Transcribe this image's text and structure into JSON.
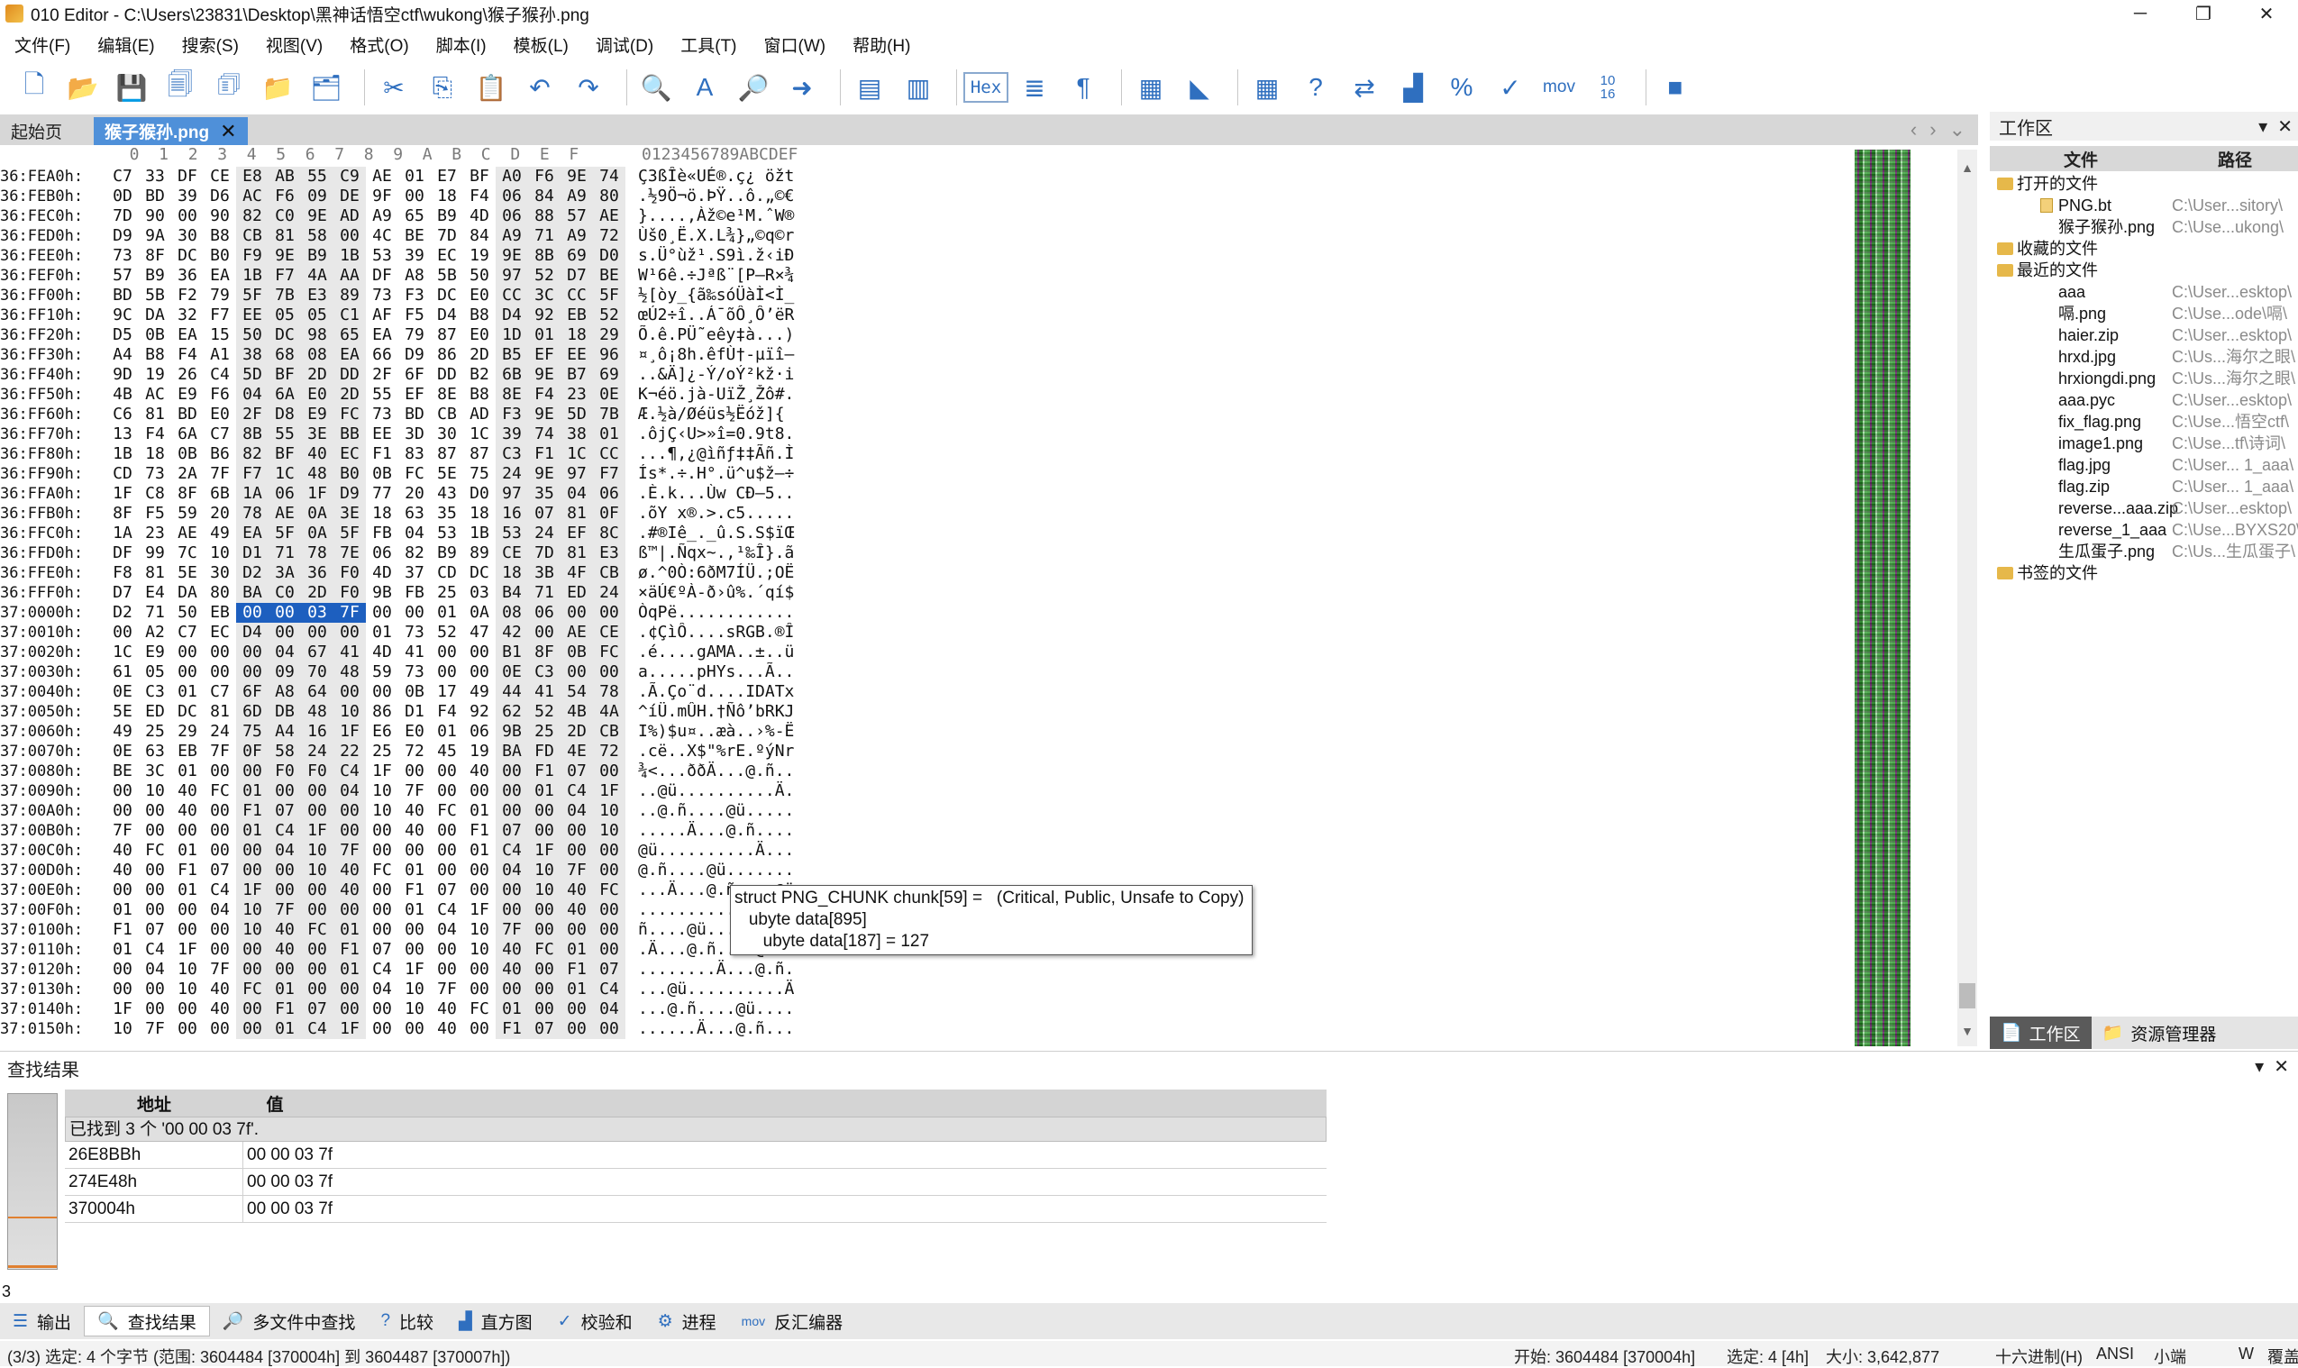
{
  "titlebar": {
    "title": "010 Editor - C:\\Users\\23831\\Desktop\\黑神话悟空ctf\\wukong\\猴子猴孙.png",
    "minimize": "─",
    "maximize": "❐",
    "close": "✕"
  },
  "menu": [
    "文件(F)",
    "编辑(E)",
    "搜索(S)",
    "视图(V)",
    "格式(O)",
    "脚本(I)",
    "模板(L)",
    "调试(D)",
    "工具(T)",
    "窗口(W)",
    "帮助(H)"
  ],
  "toolbar": {
    "hex_label": "Hex",
    "mov_label": "mov",
    "calc_label": "10\n16"
  },
  "tabs": {
    "start": "起始页",
    "file": "猴子猴孙.png",
    "close": "✕"
  },
  "hex_header": "  0  1  2  3  4  5  6  7  8  9  A  B  C  D  E  F",
  "ascii_header": "0123456789ABCDEF",
  "rows": [
    {
      "a": "36:FEA0h:",
      "h": [
        "C7",
        "33",
        "DF",
        "CE",
        "E8",
        "AB",
        "55",
        "C9",
        "AE",
        "01",
        "E7",
        "BF",
        "A0",
        "F6",
        "9E",
        "74"
      ],
      "t": "Ç3ßÎè«UÉ®.ç¿ öžt"
    },
    {
      "a": "36:FEB0h:",
      "h": [
        "0D",
        "BD",
        "39",
        "D6",
        "AC",
        "F6",
        "09",
        "DE",
        "9F",
        "00",
        "18",
        "F4",
        "06",
        "84",
        "A9",
        "80"
      ],
      "t": ".½9Ö¬ö.ÞŸ..ô.„©€"
    },
    {
      "a": "36:FEC0h:",
      "h": [
        "7D",
        "90",
        "00",
        "90",
        "82",
        "C0",
        "9E",
        "AD",
        "A9",
        "65",
        "B9",
        "4D",
        "06",
        "88",
        "57",
        "AE"
      ],
      "t": "}....‚Àž­©e¹M.ˆW®"
    },
    {
      "a": "36:FED0h:",
      "h": [
        "D9",
        "9A",
        "30",
        "B8",
        "CB",
        "81",
        "58",
        "00",
        "4C",
        "BE",
        "7D",
        "84",
        "A9",
        "71",
        "A9",
        "72"
      ],
      "t": "Ùš0¸Ë.X.L¾}„©q©r"
    },
    {
      "a": "36:FEE0h:",
      "h": [
        "73",
        "8F",
        "DC",
        "B0",
        "F9",
        "9E",
        "B9",
        "1B",
        "53",
        "39",
        "EC",
        "19",
        "9E",
        "8B",
        "69",
        "D0"
      ],
      "t": "s.Ü°ùž¹.S9ì.ž‹iÐ"
    },
    {
      "a": "36:FEF0h:",
      "h": [
        "57",
        "B9",
        "36",
        "EA",
        "1B",
        "F7",
        "4A",
        "AA",
        "DF",
        "A8",
        "5B",
        "50",
        "97",
        "52",
        "D7",
        "BE"
      ],
      "t": "W¹6ê.÷Jªß¨[P—R×¾"
    },
    {
      "a": "36:FF00h:",
      "h": [
        "BD",
        "5B",
        "F2",
        "79",
        "5F",
        "7B",
        "E3",
        "89",
        "73",
        "F3",
        "DC",
        "E0",
        "CC",
        "3C",
        "CC",
        "5F"
      ],
      "t": "½[òy_{ã‰sóÜàÌ<Ì_"
    },
    {
      "a": "36:FF10h:",
      "h": [
        "9C",
        "DA",
        "32",
        "F7",
        "EE",
        "05",
        "05",
        "C1",
        "AF",
        "F5",
        "D4",
        "B8",
        "D4",
        "92",
        "EB",
        "52"
      ],
      "t": "œÚ2÷î..Á¯õÔ¸Ô’ëR"
    },
    {
      "a": "36:FF20h:",
      "h": [
        "D5",
        "0B",
        "EA",
        "15",
        "50",
        "DC",
        "98",
        "65",
        "EA",
        "79",
        "87",
        "E0",
        "1D",
        "01",
        "18",
        "29"
      ],
      "t": "Õ.ê.PÜ˜eêy‡à...)"
    },
    {
      "a": "36:FF30h:",
      "h": [
        "A4",
        "B8",
        "F4",
        "A1",
        "38",
        "68",
        "08",
        "EA",
        "66",
        "D9",
        "86",
        "2D",
        "B5",
        "EF",
        "EE",
        "96"
      ],
      "t": "¤¸ô¡8h.êfÙ†-µïî–"
    },
    {
      "a": "36:FF40h:",
      "h": [
        "9D",
        "19",
        "26",
        "C4",
        "5D",
        "BF",
        "2D",
        "DD",
        "2F",
        "6F",
        "DD",
        "B2",
        "6B",
        "9E",
        "B7",
        "69"
      ],
      "t": "..&Ä]¿-Ý/oÝ²kž·i"
    },
    {
      "a": "36:FF50h:",
      "h": [
        "4B",
        "AC",
        "E9",
        "F6",
        "04",
        "6A",
        "E0",
        "2D",
        "55",
        "EF",
        "8E",
        "B8",
        "8E",
        "F4",
        "23",
        "0E"
      ],
      "t": "K¬éö.jà-UïŽ¸Žô#."
    },
    {
      "a": "36:FF60h:",
      "h": [
        "C6",
        "81",
        "BD",
        "E0",
        "2F",
        "D8",
        "E9",
        "FC",
        "73",
        "BD",
        "CB",
        "AD",
        "F3",
        "9E",
        "5D",
        "7B"
      ],
      "t": "Æ.½à/Øéüs½Ë­óž]{"
    },
    {
      "a": "36:FF70h:",
      "h": [
        "13",
        "F4",
        "6A",
        "C7",
        "8B",
        "55",
        "3E",
        "BB",
        "EE",
        "3D",
        "30",
        "1C",
        "39",
        "74",
        "38",
        "01"
      ],
      "t": ".ôjÇ‹U>»î=0.9t8."
    },
    {
      "a": "36:FF80h:",
      "h": [
        "1B",
        "18",
        "0B",
        "B6",
        "82",
        "BF",
        "40",
        "EC",
        "F1",
        "83",
        "87",
        "87",
        "C3",
        "F1",
        "1C",
        "CC"
      ],
      "t": "...¶‚¿@ìñƒ‡‡Ãñ.Ì"
    },
    {
      "a": "36:FF90h:",
      "h": [
        "CD",
        "73",
        "2A",
        "7F",
        "F7",
        "1C",
        "48",
        "B0",
        "0B",
        "FC",
        "5E",
        "75",
        "24",
        "9E",
        "97",
        "F7"
      ],
      "t": "Ís*.÷.H°.ü^u$ž—÷"
    },
    {
      "a": "36:FFA0h:",
      "h": [
        "1F",
        "C8",
        "8F",
        "6B",
        "1A",
        "06",
        "1F",
        "D9",
        "77",
        "20",
        "43",
        "D0",
        "97",
        "35",
        "04",
        "06"
      ],
      "t": ".È.k...Ùw CÐ—5.."
    },
    {
      "a": "36:FFB0h:",
      "h": [
        "8F",
        "F5",
        "59",
        "20",
        "78",
        "AE",
        "0A",
        "3E",
        "18",
        "63",
        "35",
        "18",
        "16",
        "07",
        "81",
        "0F"
      ],
      "t": ".õY x®.>.c5....."
    },
    {
      "a": "36:FFC0h:",
      "h": [
        "1A",
        "23",
        "AE",
        "49",
        "EA",
        "5F",
        "0A",
        "5F",
        "FB",
        "04",
        "53",
        "1B",
        "53",
        "24",
        "EF",
        "8C"
      ],
      "t": ".#®Iê_._û.S.S$ïŒ"
    },
    {
      "a": "36:FFD0h:",
      "h": [
        "DF",
        "99",
        "7C",
        "10",
        "D1",
        "71",
        "78",
        "7E",
        "06",
        "82",
        "B9",
        "89",
        "CE",
        "7D",
        "81",
        "E3"
      ],
      "t": "ß™|.Ñqx~.‚¹‰Î}.ã"
    },
    {
      "a": "36:FFE0h:",
      "h": [
        "F8",
        "81",
        "5E",
        "30",
        "D2",
        "3A",
        "36",
        "F0",
        "4D",
        "37",
        "CD",
        "DC",
        "18",
        "3B",
        "4F",
        "CB"
      ],
      "t": "ø.^0Ò:6ðM7ÍÜ.;OË"
    },
    {
      "a": "36:FFF0h:",
      "h": [
        "D7",
        "E4",
        "DA",
        "80",
        "BA",
        "C0",
        "2D",
        "F0",
        "9B",
        "FB",
        "25",
        "03",
        "B4",
        "71",
        "ED",
        "24"
      ],
      "t": "×äÚ€ºÀ-ð›û%.´qí$"
    },
    {
      "a": "37:0000h:",
      "h": [
        "D2",
        "71",
        "50",
        "EB",
        "00",
        "00",
        "03",
        "7F",
        "00",
        "00",
        "01",
        "0A",
        "08",
        "06",
        "00",
        "00"
      ],
      "t": "ÒqPë............"
    },
    {
      "a": "37:0010h:",
      "h": [
        "00",
        "A2",
        "C7",
        "EC",
        "D4",
        "00",
        "00",
        "00",
        "01",
        "73",
        "52",
        "47",
        "42",
        "00",
        "AE",
        "CE"
      ],
      "t": ".¢ÇìÔ....sRGB.®Î"
    },
    {
      "a": "37:0020h:",
      "h": [
        "1C",
        "E9",
        "00",
        "00",
        "00",
        "04",
        "67",
        "41",
        "4D",
        "41",
        "00",
        "00",
        "B1",
        "8F",
        "0B",
        "FC"
      ],
      "t": ".é....gAMA..±..ü"
    },
    {
      "a": "37:0030h:",
      "h": [
        "61",
        "05",
        "00",
        "00",
        "00",
        "09",
        "70",
        "48",
        "59",
        "73",
        "00",
        "00",
        "0E",
        "C3",
        "00",
        "00"
      ],
      "t": "a.....pHYs...Ã.."
    },
    {
      "a": "37:0040h:",
      "h": [
        "0E",
        "C3",
        "01",
        "C7",
        "6F",
        "A8",
        "64",
        "00",
        "00",
        "0B",
        "17",
        "49",
        "44",
        "41",
        "54",
        "78"
      ],
      "t": ".Ã.Ço¨d....IDATx"
    },
    {
      "a": "37:0050h:",
      "h": [
        "5E",
        "ED",
        "DC",
        "81",
        "6D",
        "DB",
        "48",
        "10",
        "86",
        "D1",
        "F4",
        "92",
        "62",
        "52",
        "4B",
        "4A"
      ],
      "t": "^íÜ.mÛH.†Ñô’bRKJ"
    },
    {
      "a": "37:0060h:",
      "h": [
        "49",
        "25",
        "29",
        "24",
        "75",
        "A4",
        "16",
        "1F",
        "E6",
        "E0",
        "01",
        "06",
        "9B",
        "25",
        "2D",
        "CB"
      ],
      "t": "I%)$u¤..æà..›%-Ë"
    },
    {
      "a": "37:0070h:",
      "h": [
        "0E",
        "63",
        "EB",
        "7F",
        "0F",
        "58",
        "24",
        "22",
        "25",
        "72",
        "45",
        "19",
        "BA",
        "FD",
        "4E",
        "72"
      ],
      "t": ".cë..X$\"%rE.ºýNr"
    },
    {
      "a": "37:0080h:",
      "h": [
        "BE",
        "3C",
        "01",
        "00",
        "00",
        "F0",
        "F0",
        "C4",
        "1F",
        "00",
        "00",
        "40",
        "00",
        "F1",
        "07",
        "00"
      ],
      "t": "¾<...ððÄ...@.ñ.."
    },
    {
      "a": "37:0090h:",
      "h": [
        "00",
        "10",
        "40",
        "FC",
        "01",
        "00",
        "00",
        "04",
        "10",
        "7F",
        "00",
        "00",
        "00",
        "01",
        "C4",
        "1F"
      ],
      "t": "..@ü..........Ä."
    },
    {
      "a": "37:00A0h:",
      "h": [
        "00",
        "00",
        "40",
        "00",
        "F1",
        "07",
        "00",
        "00",
        "10",
        "40",
        "FC",
        "01",
        "00",
        "00",
        "04",
        "10"
      ],
      "t": "..@.ñ....@ü....."
    },
    {
      "a": "37:00B0h:",
      "h": [
        "7F",
        "00",
        "00",
        "00",
        "01",
        "C4",
        "1F",
        "00",
        "00",
        "40",
        "00",
        "F1",
        "07",
        "00",
        "00",
        "10"
      ],
      "t": ".....Ä...@.ñ...."
    },
    {
      "a": "37:00C0h:",
      "h": [
        "40",
        "FC",
        "01",
        "00",
        "00",
        "04",
        "10",
        "7F",
        "00",
        "00",
        "00",
        "01",
        "C4",
        "1F",
        "00",
        "00"
      ],
      "t": "@ü..........Ä..."
    },
    {
      "a": "37:00D0h:",
      "h": [
        "40",
        "00",
        "F1",
        "07",
        "00",
        "00",
        "10",
        "40",
        "FC",
        "01",
        "00",
        "00",
        "04",
        "10",
        "7F",
        "00"
      ],
      "t": "@.ñ....@ü......."
    },
    {
      "a": "37:00E0h:",
      "h": [
        "00",
        "00",
        "01",
        "C4",
        "1F",
        "00",
        "00",
        "40",
        "00",
        "F1",
        "07",
        "00",
        "00",
        "10",
        "40",
        "FC"
      ],
      "t": "...Ä...@.ñ....@ü"
    },
    {
      "a": "37:00F0h:",
      "h": [
        "01",
        "00",
        "00",
        "04",
        "10",
        "7F",
        "00",
        "00",
        "00",
        "01",
        "C4",
        "1F",
        "00",
        "00",
        "40",
        "00"
      ],
      "t": "..........Ä...@."
    },
    {
      "a": "37:0100h:",
      "h": [
        "F1",
        "07",
        "00",
        "00",
        "10",
        "40",
        "FC",
        "01",
        "00",
        "00",
        "04",
        "10",
        "7F",
        "00",
        "00",
        "00"
      ],
      "t": "ñ....@ü........."
    },
    {
      "a": "37:0110h:",
      "h": [
        "01",
        "C4",
        "1F",
        "00",
        "00",
        "40",
        "00",
        "F1",
        "07",
        "00",
        "00",
        "10",
        "40",
        "FC",
        "01",
        "00"
      ],
      "t": ".Ä...@.ñ....@ü.."
    },
    {
      "a": "37:0120h:",
      "h": [
        "00",
        "04",
        "10",
        "7F",
        "00",
        "00",
        "00",
        "01",
        "C4",
        "1F",
        "00",
        "00",
        "40",
        "00",
        "F1",
        "07"
      ],
      "t": "........Ä...@.ñ."
    },
    {
      "a": "37:0130h:",
      "h": [
        "00",
        "00",
        "10",
        "40",
        "FC",
        "01",
        "00",
        "00",
        "04",
        "10",
        "7F",
        "00",
        "00",
        "00",
        "01",
        "C4"
      ],
      "t": "...@ü..........Ä"
    },
    {
      "a": "37:0140h:",
      "h": [
        "1F",
        "00",
        "00",
        "40",
        "00",
        "F1",
        "07",
        "00",
        "00",
        "10",
        "40",
        "FC",
        "01",
        "00",
        "00",
        "04"
      ],
      "t": "...@.ñ....@ü...."
    },
    {
      "a": "37:0150h:",
      "h": [
        "10",
        "7F",
        "00",
        "00",
        "00",
        "01",
        "C4",
        "1F",
        "00",
        "00",
        "40",
        "00",
        "F1",
        "07",
        "00",
        "00"
      ],
      "t": "......Ä...@.ñ..."
    }
  ],
  "tooltip": {
    "line1": "struct PNG_CHUNK chunk[59] =   (Critical, Public, Unsafe to Copy)",
    "line2": "   ubyte data[895]",
    "line3": "      ubyte data[187] = 127"
  },
  "workspace": {
    "title": "工作区",
    "col_file": "文件",
    "col_path": "路径",
    "items": [
      {
        "type": "folder",
        "name": "打开的文件",
        "path": "",
        "indent": 0
      },
      {
        "type": "file",
        "name": "PNG.bt",
        "path": "C:\\User...sitory\\",
        "indent": 1
      },
      {
        "type": "file",
        "name": "猴子猴孙.png",
        "path": "C:\\Use...ukong\\",
        "indent": 1
      },
      {
        "type": "folder",
        "name": "收藏的文件",
        "path": "",
        "indent": 0
      },
      {
        "type": "folder",
        "name": "最近的文件",
        "path": "",
        "indent": 0
      },
      {
        "type": "file",
        "name": "aaa",
        "path": "C:\\User...esktop\\",
        "indent": 1
      },
      {
        "type": "file",
        "name": "嗝.png",
        "path": "C:\\Use...ode\\嗝\\",
        "indent": 1
      },
      {
        "type": "file",
        "name": "haier.zip",
        "path": "C:\\User...esktop\\",
        "indent": 1
      },
      {
        "type": "file",
        "name": "hrxd.jpg",
        "path": "C:\\Us...海尔之眼\\",
        "indent": 1
      },
      {
        "type": "file",
        "name": "hrxiongdi.png",
        "path": "C:\\Us...海尔之眼\\",
        "indent": 1
      },
      {
        "type": "file",
        "name": "aaa.pyc",
        "path": "C:\\User...esktop\\",
        "indent": 1
      },
      {
        "type": "file",
        "name": "fix_flag.png",
        "path": "C:\\Use...悟空ctf\\",
        "indent": 1
      },
      {
        "type": "file",
        "name": "image1.png",
        "path": "C:\\Use...tf\\诗词\\",
        "indent": 1
      },
      {
        "type": "file",
        "name": "flag.jpg",
        "path": "C:\\User... 1_aaa\\",
        "indent": 1
      },
      {
        "type": "file",
        "name": "flag.zip",
        "path": "C:\\User... 1_aaa\\",
        "indent": 1
      },
      {
        "type": "file",
        "name": "reverse...aaa.zip",
        "path": "C:\\User...esktop\\",
        "indent": 1
      },
      {
        "type": "file",
        "name": "reverse_1_aaa",
        "path": "C:\\Use...BYXS20\\",
        "indent": 1
      },
      {
        "type": "file",
        "name": "生瓜蛋子.png",
        "path": "C:\\Us...生瓜蛋子\\",
        "indent": 1
      },
      {
        "type": "folder",
        "name": "书签的文件",
        "path": "",
        "indent": 0
      }
    ],
    "tab_workspace": "工作区",
    "tab_explorer": "资源管理器"
  },
  "find": {
    "title": "查找结果",
    "col_addr": "地址",
    "col_value": "值",
    "summary": "已找到 3 个 '00 00 03 7f'.",
    "results": [
      {
        "addr": "26E8BBh",
        "value": "00 00 03 7f"
      },
      {
        "addr": "274E48h",
        "value": "00 00 03 7f"
      },
      {
        "addr": "370004h",
        "value": "00 00 03 7f"
      }
    ],
    "count": "3"
  },
  "bottom_tabs": [
    "输出",
    "查找结果",
    "多文件中查找",
    "比较",
    "直方图",
    "校验和",
    "进程",
    "反汇编器"
  ],
  "status": {
    "left": "(3/3) 选定: 4 个字节 (范围: 3604484 [370004h] 到 3604487 [370007h])",
    "start": "开始: 3604484 [370004h]",
    "sel": "选定: 4 [4h]",
    "size": "大小: 3,642,877",
    "base": "十六进制(H)",
    "enc": "ANSI",
    "endian": "小端",
    "mode": "W",
    "ovr": "覆盖"
  },
  "colors": {
    "selection": "#1d5fbf",
    "tab_active": "#4f90d9",
    "accent": "#2f6fbf"
  }
}
